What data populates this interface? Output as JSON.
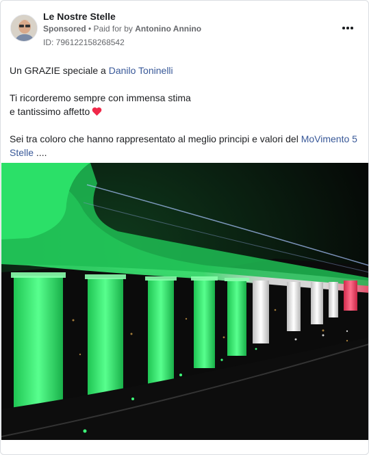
{
  "post": {
    "page_name": "Le Nostre Stelle",
    "sponsored_label": "Sponsored",
    "dot": " • ",
    "paid_for_prefix": "Paid for by ",
    "paid_for_name": "Antonino Annino",
    "id_label": "ID: 796122158268542",
    "more_icon": "more-horizontal-icon"
  },
  "text": {
    "line1_prefix": "Un GRAZIE speciale a ",
    "line1_link": "Danilo Toninelli",
    "line2": "Ti ricorderemo sempre con immensa stima",
    "line3": "e tantissimo affetto",
    "heart_icon": "red-heart-icon",
    "line4_prefix": "Sei tra coloro che hanno rappresentato al meglio principi e valori del ",
    "line4_link_a": "MoVimento 5",
    "line4_link_b": "Stelle",
    "line4_suffix": " ...."
  },
  "colors": {
    "link": "#385898",
    "muted": "#65676b",
    "heart": "#f02849",
    "bridge_green": "#3dff7a",
    "bridge_white": "#f4f4f4",
    "bridge_red": "#ff4d6d"
  }
}
